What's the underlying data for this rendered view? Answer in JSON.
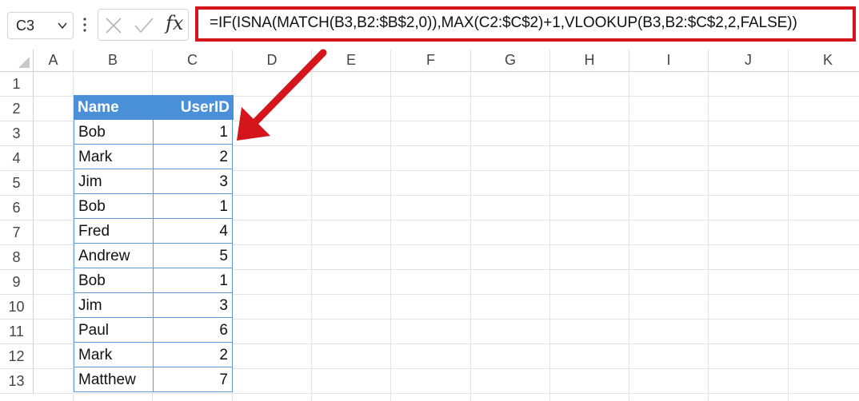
{
  "name_box": {
    "value": "C3"
  },
  "formula_bar": {
    "fx_label": "fx",
    "formula": "=IF(ISNA(MATCH(B3,B2:$B$2,0)),MAX(C2:$C$2)+1,VLOOKUP(B3,B2:$C$2,2,FALSE))"
  },
  "columns": [
    "A",
    "B",
    "C",
    "D",
    "E",
    "F",
    "G",
    "H",
    "I",
    "J",
    "K"
  ],
  "rows": [
    "1",
    "2",
    "3",
    "4",
    "5",
    "6",
    "7",
    "8",
    "9",
    "10",
    "11",
    "12",
    "13"
  ],
  "table": {
    "headers": [
      "Name",
      "UserID"
    ],
    "rows": [
      [
        "Bob",
        "1"
      ],
      [
        "Mark",
        "2"
      ],
      [
        "Jim",
        "3"
      ],
      [
        "Bob",
        "1"
      ],
      [
        "Fred",
        "4"
      ],
      [
        "Andrew",
        "5"
      ],
      [
        "Bob",
        "1"
      ],
      [
        "Jim",
        "3"
      ],
      [
        "Paul",
        "6"
      ],
      [
        "Mark",
        "2"
      ],
      [
        "Matthew",
        "7"
      ]
    ]
  },
  "colors": {
    "highlight": "#d4161c",
    "table_header": "#4a90d9",
    "table_border": "#5a9bd8"
  }
}
